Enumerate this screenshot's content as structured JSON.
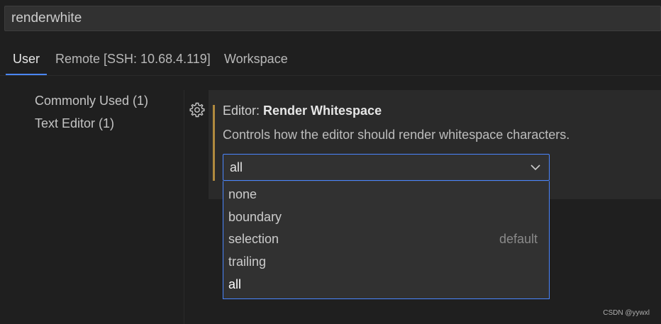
{
  "search": {
    "value": "renderwhite"
  },
  "tabs": [
    {
      "label": "User",
      "active": true
    },
    {
      "label": "Remote [SSH: 10.68.4.119]",
      "active": false
    },
    {
      "label": "Workspace",
      "active": false
    }
  ],
  "toc": {
    "items": [
      {
        "label": "Commonly Used (1)"
      },
      {
        "label": "Text Editor (1)"
      }
    ]
  },
  "setting": {
    "icon": "gear-icon",
    "category": "Editor: ",
    "name": "Render Whitespace",
    "description": "Controls how the editor should render whitespace characters.",
    "accent_color": "#b08a3e",
    "current_value": "all"
  },
  "dropdown": {
    "options": [
      {
        "label": "none",
        "hint": ""
      },
      {
        "label": "boundary",
        "hint": ""
      },
      {
        "label": "selection",
        "hint": "default"
      },
      {
        "label": "trailing",
        "hint": ""
      },
      {
        "label": "all",
        "hint": ""
      }
    ],
    "selected": "all",
    "focus_color": "#4a86ff"
  },
  "watermark": "CSDN @yywxl"
}
